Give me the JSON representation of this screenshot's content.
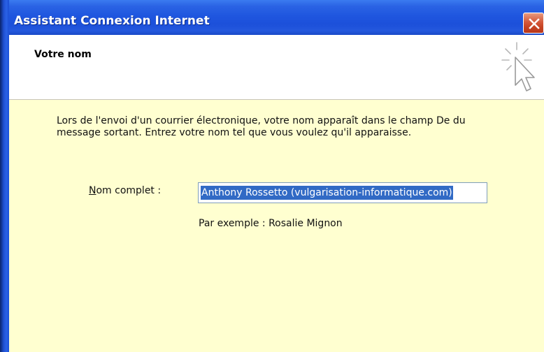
{
  "window": {
    "title": "Assistant Connexion Internet"
  },
  "header": {
    "title": "Votre nom",
    "icon": "wizard-cursor-sparkle-icon"
  },
  "content": {
    "description": "Lors de l'envoi d'un courrier électronique, votre nom apparaît dans le champ De du message sortant. Entrez votre nom tel que vous voulez qu'il apparaisse.",
    "name_label_mnemonic": "N",
    "name_label_rest": "om complet :",
    "name_value": "Anthony Rossetto (vulgarisation-informatique.com)",
    "example": "Par exemple : Rosalie Mignon"
  },
  "colors": {
    "titlebar": "#1f56df",
    "content_bg": "#ffffd0",
    "selection": "#316ac5",
    "close_button": "#c64323"
  }
}
